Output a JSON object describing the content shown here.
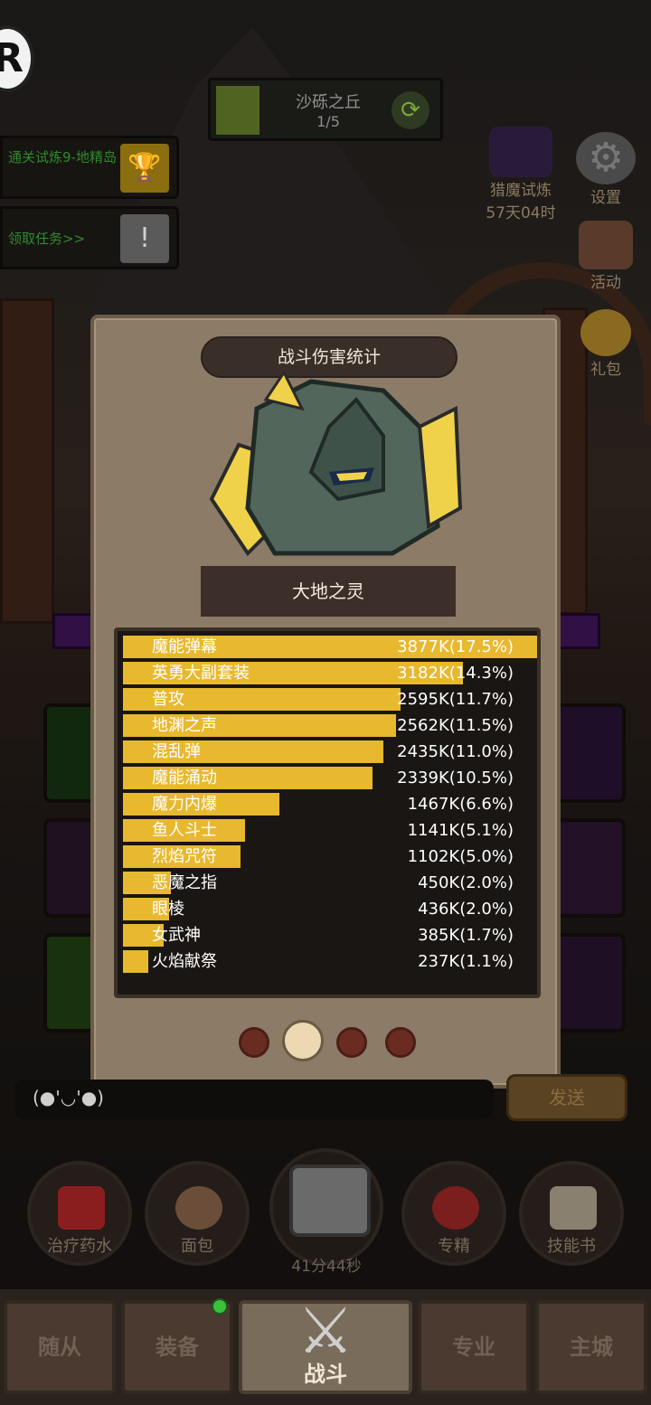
{
  "header": {
    "logo_char": "R"
  },
  "stage": {
    "name": "沙砾之丘",
    "progress": "1/5"
  },
  "quests": [
    {
      "text": "通关试炼9-地精岛"
    },
    {
      "text": "领取任务>>"
    }
  ],
  "side_icons": {
    "hunt_trial": "猎魔试炼",
    "hunt_trial_timer": "57天04时",
    "settings": "设置",
    "event": "活动",
    "gift": "礼包"
  },
  "dialog": {
    "title": "战斗伤害统计",
    "monster_name": "大地之灵",
    "damage_rows": [
      {
        "skill": "魔能弹幕",
        "damage": "3877K(17.5%)",
        "share": 1.0
      },
      {
        "skill": "英勇大副套装",
        "damage": "3182K(14.3%)",
        "share": 0.82
      },
      {
        "skill": "普攻",
        "damage": "2595K(11.7%)",
        "share": 0.67
      },
      {
        "skill": "地渊之声",
        "damage": "2562K(11.5%)",
        "share": 0.66
      },
      {
        "skill": "混乱弹",
        "damage": "2435K(11.0%)",
        "share": 0.628
      },
      {
        "skill": "魔能涌动",
        "damage": "2339K(10.5%)",
        "share": 0.603
      },
      {
        "skill": "魔力内爆",
        "damage": "1467K(6.6%)",
        "share": 0.378
      },
      {
        "skill": "鱼人斗士",
        "damage": "1141K(5.1%)",
        "share": 0.294
      },
      {
        "skill": "烈焰咒符",
        "damage": "1102K(5.0%)",
        "share": 0.284
      },
      {
        "skill": "恶魔之指",
        "damage": "450K(2.0%)",
        "share": 0.116
      },
      {
        "skill": "眼棱",
        "damage": "436K(2.0%)",
        "share": 0.112
      },
      {
        "skill": "女武神",
        "damage": "385K(1.7%)",
        "share": 0.099
      },
      {
        "skill": "火焰献祭",
        "damage": "237K(1.1%)",
        "share": 0.061
      }
    ],
    "bar_color": "#e8b82e"
  },
  "chat": {
    "text": "(●'◡'●)",
    "send_label": "发送"
  },
  "items": {
    "0": "治疗药水",
    "1": "面包",
    "2": "专精",
    "3": "技能书",
    "chest_timer": "41分44秒"
  },
  "nav": [
    "随从",
    "装备",
    "战斗",
    "专业",
    "主城"
  ]
}
